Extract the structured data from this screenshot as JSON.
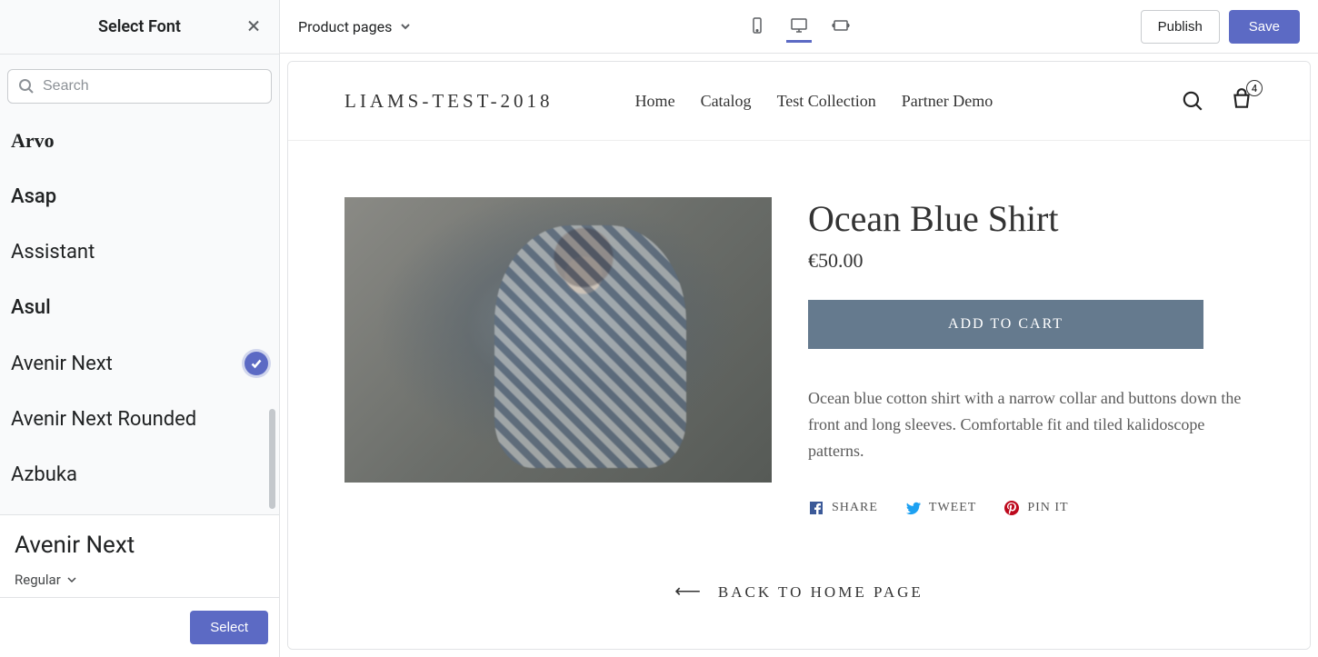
{
  "sidebar": {
    "title": "Select Font",
    "search_placeholder": "Search",
    "fonts": [
      {
        "name": "Arvo",
        "selected": false
      },
      {
        "name": "Asap",
        "selected": false
      },
      {
        "name": "Assistant",
        "selected": false
      },
      {
        "name": "Asul",
        "selected": false
      },
      {
        "name": "Avenir Next",
        "selected": true
      },
      {
        "name": "Avenir Next Rounded",
        "selected": false
      },
      {
        "name": "Azbuka",
        "selected": false
      }
    ],
    "selected_font": "Avenir Next",
    "selected_weight": "Regular",
    "select_button": "Select"
  },
  "topbar": {
    "page_selector": "Product pages",
    "publish": "Publish",
    "save": "Save"
  },
  "preview": {
    "store_name": "LIAMS-TEST-2018",
    "nav": [
      "Home",
      "Catalog",
      "Test Collection",
      "Partner Demo"
    ],
    "cart_count": "4",
    "product": {
      "title": "Ocean Blue Shirt",
      "price": "€50.00",
      "add_to_cart": "ADD TO CART",
      "description": "Ocean blue cotton shirt with a narrow collar and buttons down the front and long sleeves. Comfortable fit and tiled kalidoscope patterns.",
      "share": "SHARE",
      "tweet": "TWEET",
      "pin": "PIN IT"
    },
    "back_link": "BACK TO HOME PAGE"
  }
}
